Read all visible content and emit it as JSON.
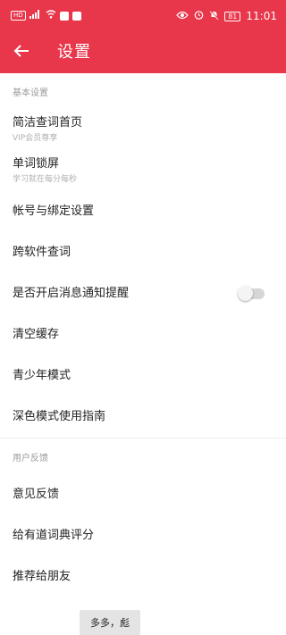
{
  "status_bar": {
    "network_badge": "HD",
    "signal_text": "4G",
    "battery_level": "81",
    "time": "11:01"
  },
  "app_bar": {
    "back_label": "←",
    "title": "设置"
  },
  "sections": {
    "basic": {
      "header": "基本设置",
      "items": [
        {
          "title": "简洁查词首页",
          "subtitle": "VIP会员尊享"
        },
        {
          "title": "单词锁屏",
          "subtitle": "学习就在每分每秒"
        },
        {
          "title": "帐号与绑定设置"
        },
        {
          "title": "跨软件查词"
        },
        {
          "title": "是否开启消息通知提醒",
          "toggle": false
        },
        {
          "title": "清空缓存"
        },
        {
          "title": "青少年模式"
        },
        {
          "title": "深色模式使用指南"
        }
      ]
    },
    "feedback": {
      "header": "用户反馈",
      "items": [
        {
          "title": "意见反馈"
        },
        {
          "title": "给有道词典评分"
        },
        {
          "title": "推荐给朋友"
        }
      ]
    }
  },
  "toast": {
    "text": "多多，彪"
  },
  "colors": {
    "accent": "#e8364b",
    "background": "#ffffff",
    "secondary_text": "#9a9a9a"
  }
}
